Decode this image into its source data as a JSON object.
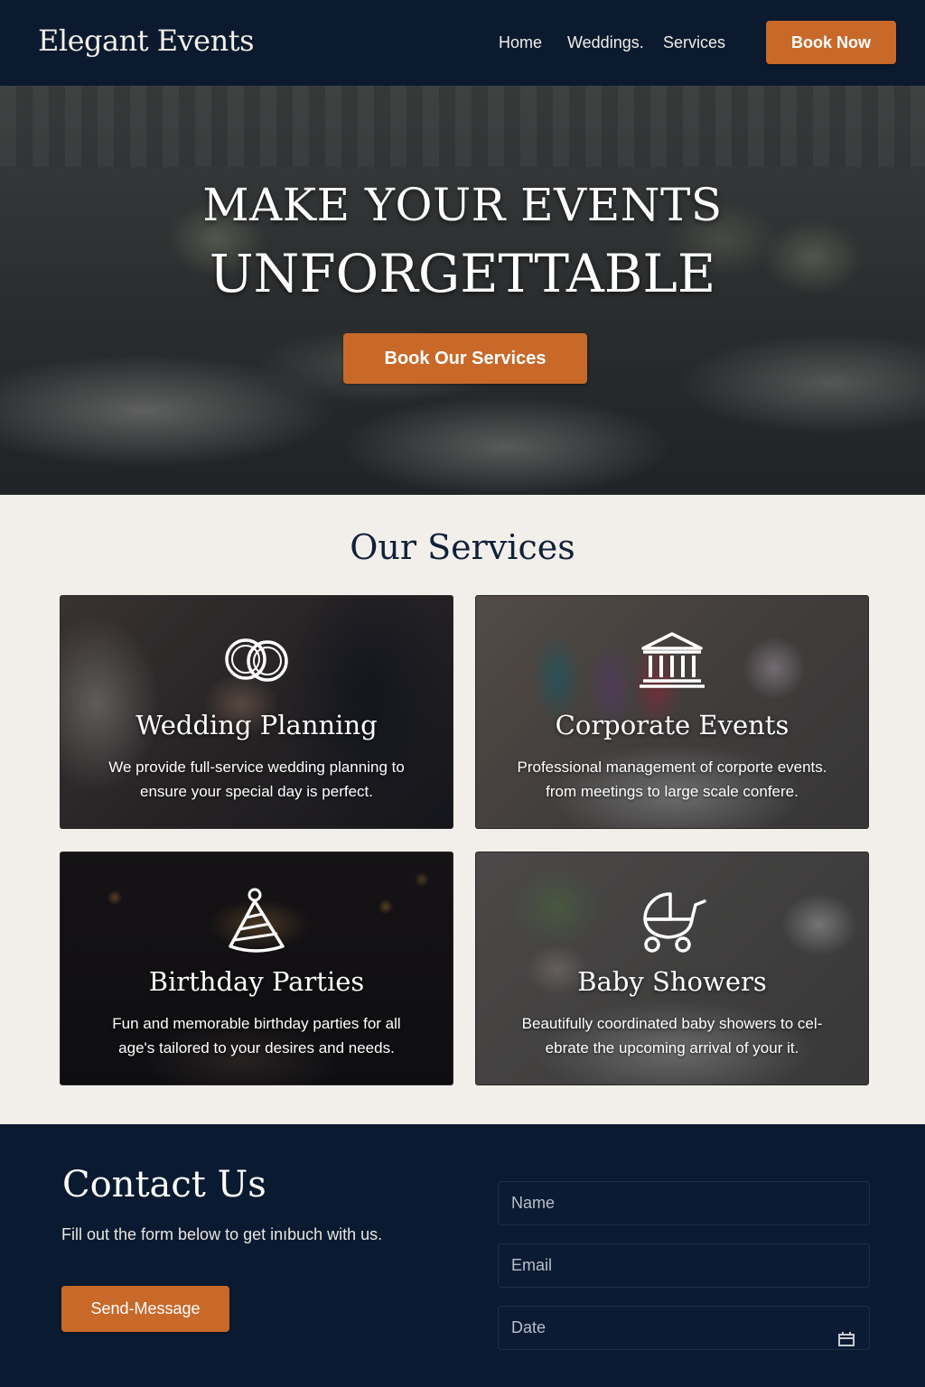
{
  "header": {
    "logo": "Elegant Events",
    "nav": [
      "Home",
      "Weddings.",
      "Services"
    ],
    "cta": "Book Now"
  },
  "hero": {
    "line1": "MAKE YOUR EVENTS",
    "line2": "UNFORGETTABLE",
    "button": "Book Our Services"
  },
  "services": {
    "title": "Our Services",
    "cards": [
      {
        "icon": "rings-icon",
        "title": "Wedding Planning",
        "description": "We provide full-service wedding planning to ensure your special day is perfect."
      },
      {
        "icon": "building-icon",
        "title": "Corporate Events",
        "description": "Professional management of corporte events. from meetings to large scale confere."
      },
      {
        "icon": "party-hat-icon",
        "title": "Birthday Parties",
        "description": "Fun and memorable birthday parties for all age's tailored to your desires and needs."
      },
      {
        "icon": "stroller-icon",
        "title": "Baby Showers",
        "description": "Beautifully coordinated baby showers to cel-ebrate the upcoming arrival of your it."
      }
    ]
  },
  "contact": {
    "title": "Contact Us",
    "subtitle": "Fill out the form below to get inıbuch with us.",
    "button": "Send-Message",
    "fields": {
      "name_placeholder": "Name",
      "email_placeholder": "Email",
      "date_placeholder": "Date"
    }
  },
  "colors": {
    "navy": "#0b1a2f",
    "accent_orange": "#c8692a",
    "cream": "#f2efea"
  }
}
